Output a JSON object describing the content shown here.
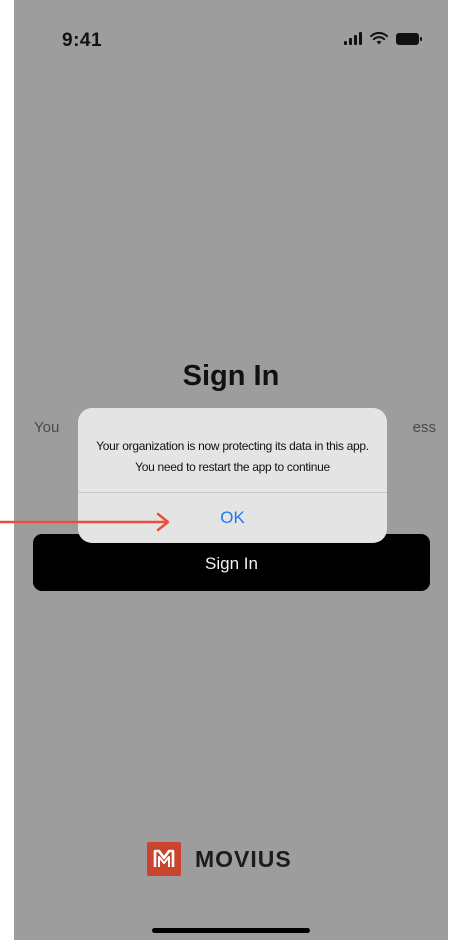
{
  "status_bar": {
    "time": "9:41",
    "icons": [
      "signal-icon",
      "wifi-icon",
      "battery-icon"
    ]
  },
  "screen": {
    "title": "Sign In",
    "subtitle_left_fragment": "You",
    "subtitle_right_fragment": "ess",
    "signin_button_label": "Sign In"
  },
  "dialog": {
    "message": "Your organization is now protecting its data in this app. You need to restart the app to continue",
    "ok_label": "OK"
  },
  "logo": {
    "text": "MOVIUS",
    "mark_color": "#c9432e"
  },
  "colors": {
    "overlay_background": "#9d9d9d",
    "dialog_background": "#e4e4e4",
    "ok_text": "#1a7cf5",
    "annotation_arrow": "#e8503a"
  }
}
